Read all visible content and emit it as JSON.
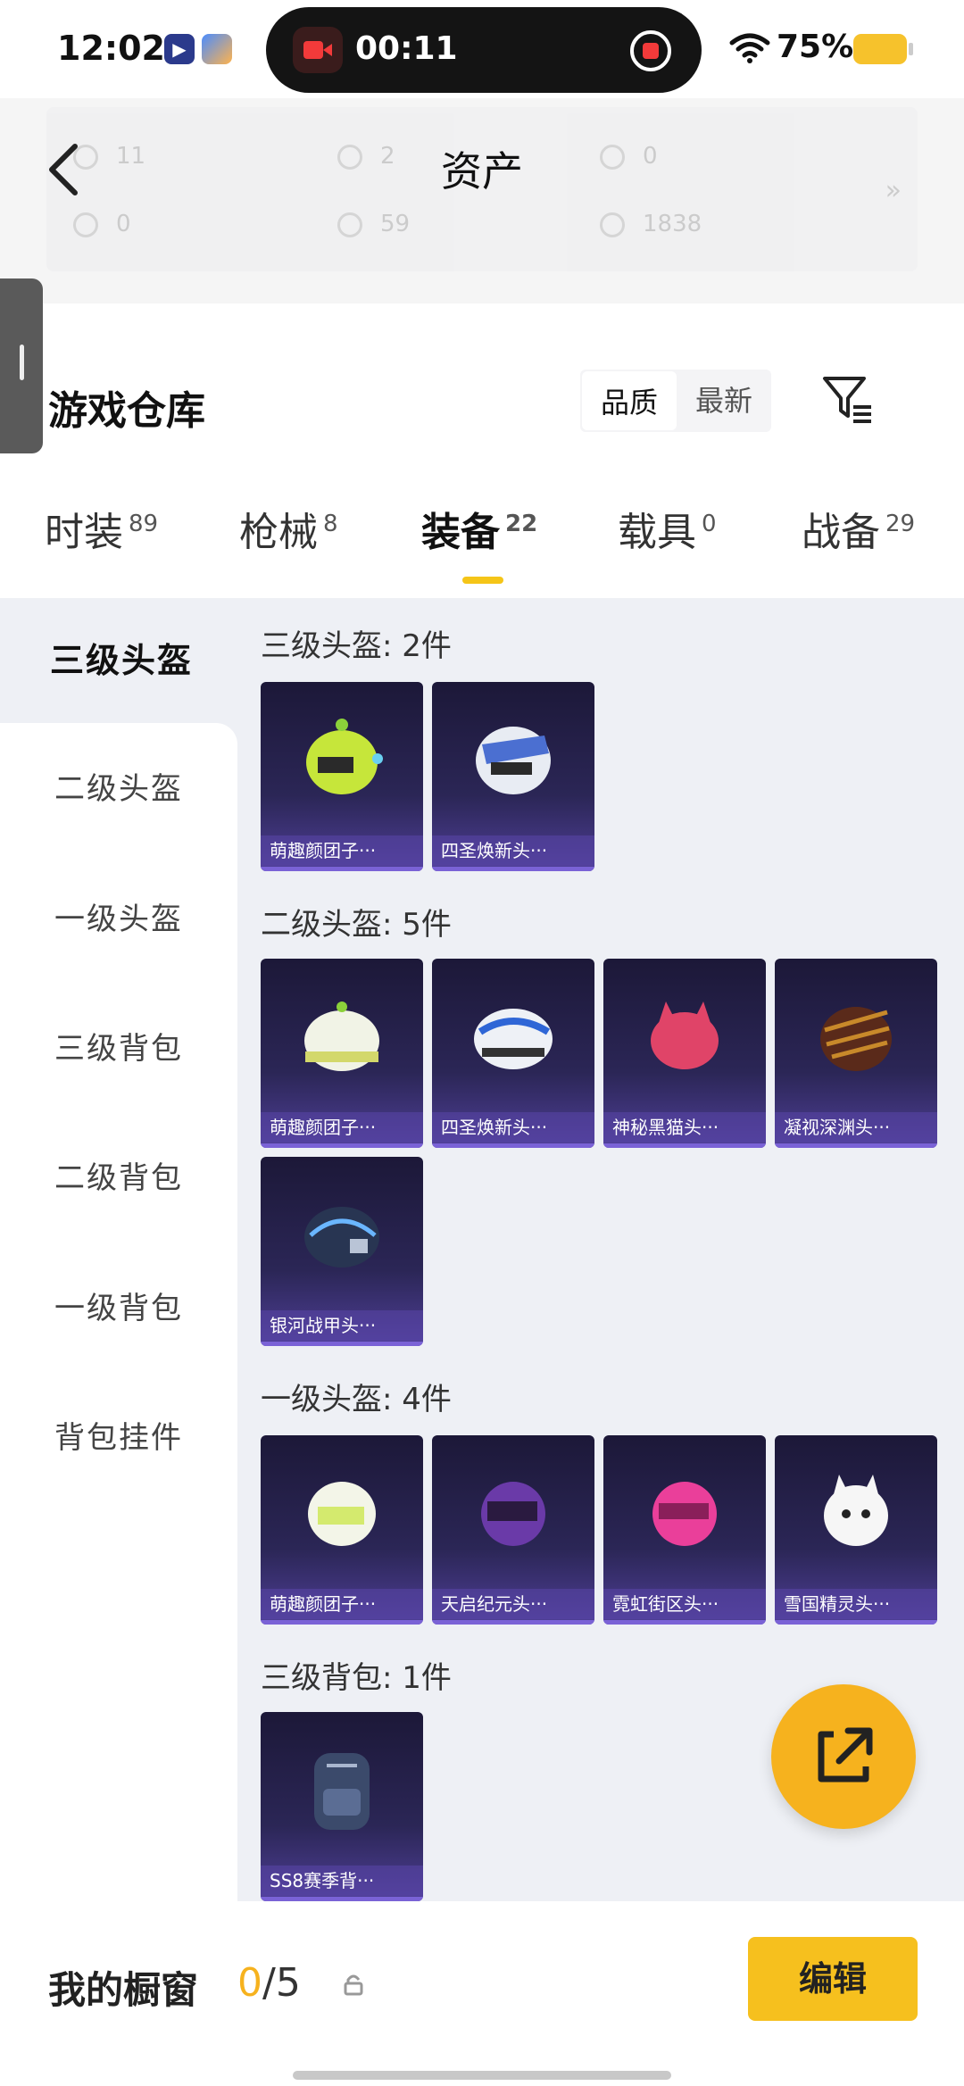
{
  "status_bar": {
    "time": "12:02",
    "recording_time": "00:11",
    "battery": "75%"
  },
  "header": {
    "title": "资产",
    "assets": [
      {
        "value": "11"
      },
      {
        "value": "2"
      },
      {
        "value": "0"
      },
      {
        "value": "0"
      },
      {
        "value": "59"
      },
      {
        "value": "1838"
      }
    ]
  },
  "warehouse": {
    "title": "游戏仓库",
    "sort_options": [
      "品质",
      "最新"
    ]
  },
  "tabs": [
    {
      "label": "时装",
      "count": "89"
    },
    {
      "label": "枪械",
      "count": "8"
    },
    {
      "label": "装备",
      "count": "22"
    },
    {
      "label": "载具",
      "count": "0"
    },
    {
      "label": "战备",
      "count": "29"
    }
  ],
  "sidebar": {
    "items": [
      "三级头盔",
      "二级头盔",
      "一级头盔",
      "三级背包",
      "二级背包",
      "一级背包",
      "背包挂件"
    ]
  },
  "sections": [
    {
      "title": "三级头盔: 2件",
      "items": [
        "萌趣颜团子···",
        "四圣焕新头···"
      ]
    },
    {
      "title": "二级头盔: 5件",
      "items": [
        "萌趣颜团子···",
        "四圣焕新头···",
        "神秘黑猫头···",
        "凝视深渊头···",
        "银河战甲头···"
      ]
    },
    {
      "title": "一级头盔: 4件",
      "items": [
        "萌趣颜团子···",
        "天启纪元头···",
        "霓虹街区头···",
        "雪国精灵头···"
      ]
    },
    {
      "title": "三级背包: 1件",
      "items": [
        "SS8赛季背···"
      ]
    }
  ],
  "bottom_bar": {
    "showcase_label": "我的橱窗",
    "showcase_current": "0",
    "showcase_total": "/5",
    "edit_label": "编辑"
  }
}
